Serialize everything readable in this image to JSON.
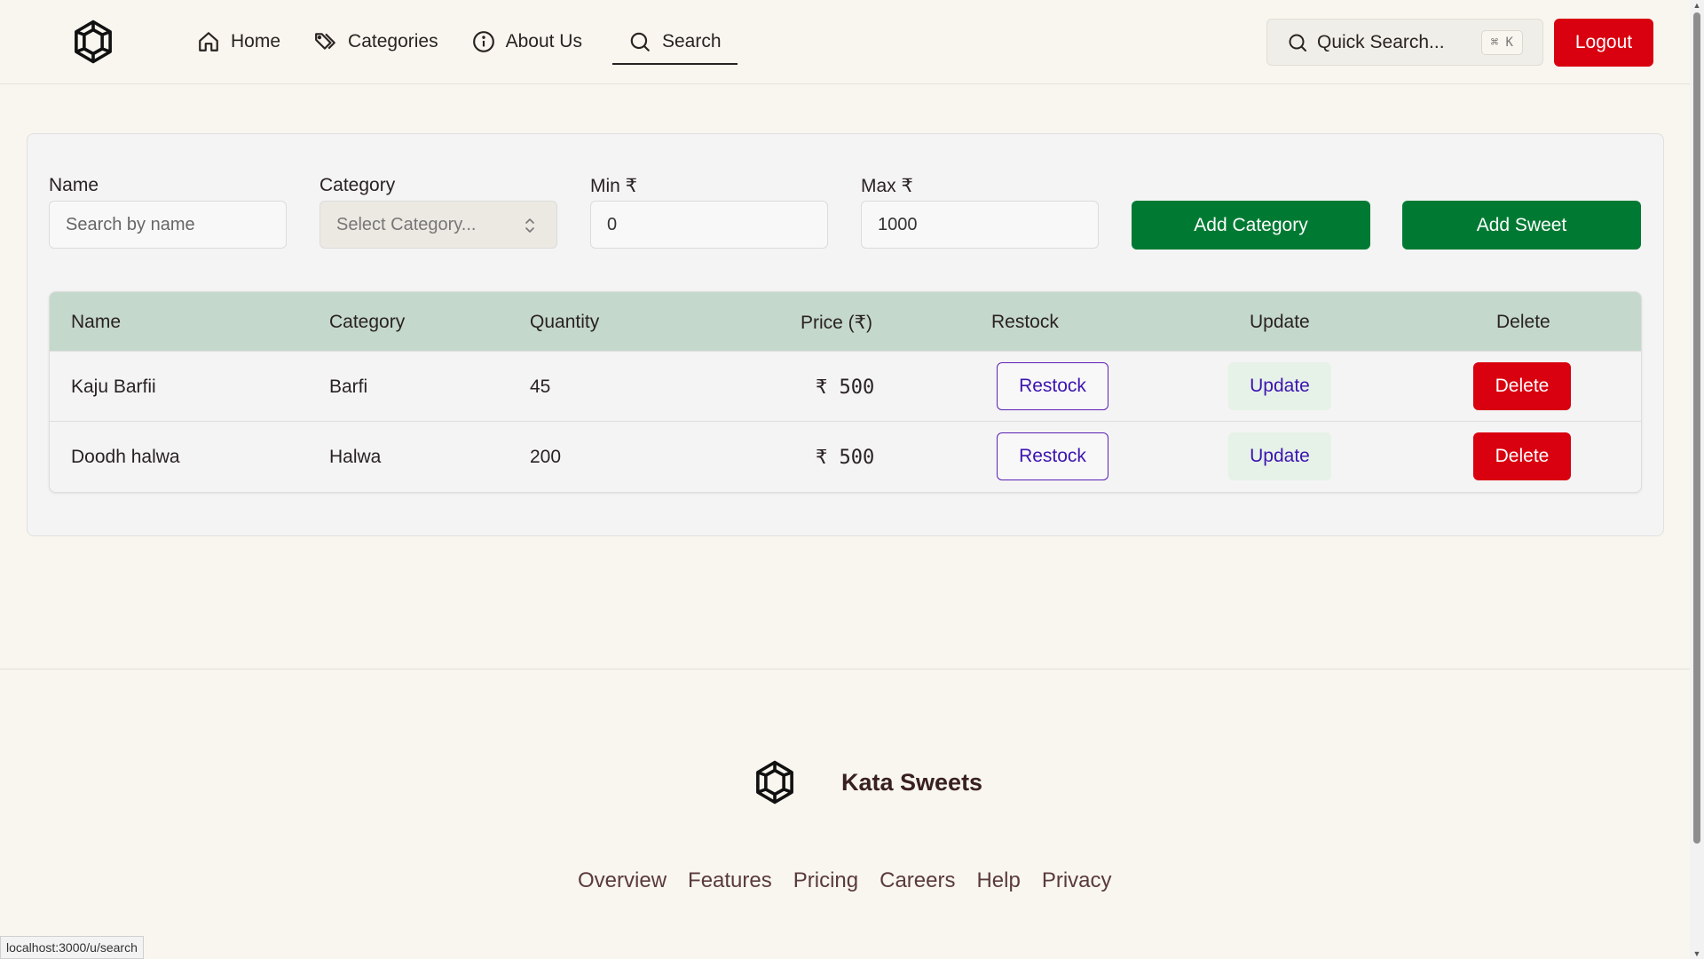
{
  "nav": {
    "items": [
      {
        "label": "Home",
        "icon": "home-icon"
      },
      {
        "label": "Categories",
        "icon": "tags-icon"
      },
      {
        "label": "About Us",
        "icon": "info-icon"
      },
      {
        "label": "Search",
        "icon": "search-icon",
        "active": true
      }
    ]
  },
  "quick_search": {
    "label": "Quick Search...",
    "shortcut": "⌘ K"
  },
  "logout_label": "Logout",
  "filters": {
    "name_label": "Name",
    "name_placeholder": "Search by name",
    "category_label": "Category",
    "category_placeholder": "Select Category...",
    "min_label": "Min ₹",
    "min_value": "0",
    "max_label": "Max ₹",
    "max_value": "1000",
    "add_category_label": "Add Category",
    "add_sweet_label": "Add Sweet"
  },
  "table": {
    "headers": [
      "Name",
      "Category",
      "Quantity",
      "Price (₹)",
      "Restock",
      "Update",
      "Delete"
    ],
    "rows": [
      {
        "name": "Kaju Barfii",
        "category": "Barfi",
        "quantity": "45",
        "price": "₹ 500",
        "restock": "Restock",
        "update": "Update",
        "delete": "Delete"
      },
      {
        "name": "Doodh halwa",
        "category": "Halwa",
        "quantity": "200",
        "price": "₹ 500",
        "restock": "Restock",
        "update": "Update",
        "delete": "Delete"
      }
    ]
  },
  "footer": {
    "brand": "Kata Sweets",
    "links": [
      "Overview",
      "Features",
      "Pricing",
      "Careers",
      "Help",
      "Privacy"
    ]
  },
  "status_url": "localhost:3000/u/search",
  "colors": {
    "background": "#f8f6ef",
    "primary_green": "#007a33",
    "danger_red": "#d9000f",
    "table_header": "#c4d8cc",
    "accent_purple": "#3d14b0"
  }
}
